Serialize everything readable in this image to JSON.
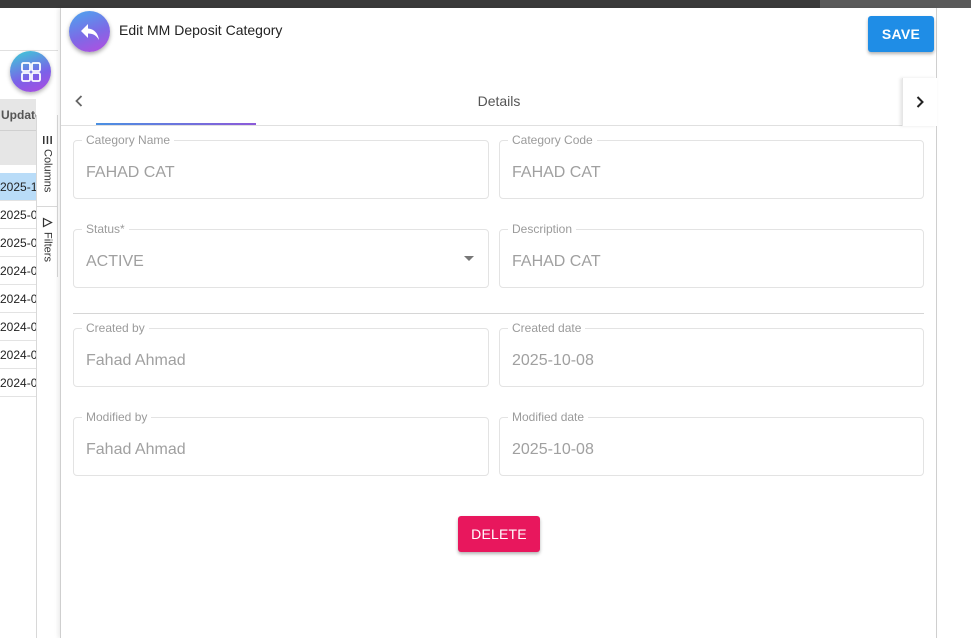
{
  "background_grid": {
    "header_label": "Update",
    "rows": [
      "2025-1",
      "2025-0",
      "2025-0",
      "2024-0",
      "2024-0",
      "2024-0",
      "2024-0",
      "2024-0"
    ],
    "side_tabs": {
      "columns": "Columns",
      "filters": "Filters"
    }
  },
  "dialog": {
    "title": "Edit MM Deposit Category",
    "save_label": "SAVE",
    "delete_label": "DELETE",
    "tab_label": "Details",
    "fields": {
      "category_name": {
        "label": "Category Name",
        "value": "FAHAD CAT"
      },
      "category_code": {
        "label": "Category Code",
        "value": "FAHAD CAT"
      },
      "status": {
        "label": "Status*",
        "value": "ACTIVE"
      },
      "description": {
        "label": "Description",
        "value": "FAHAD CAT"
      },
      "created_by": {
        "label": "Created by",
        "value": "Fahad Ahmad"
      },
      "created_date": {
        "label": "Created date",
        "value": "2025-10-08"
      },
      "modified_by": {
        "label": "Modified by",
        "value": "Fahad Ahmad"
      },
      "modified_date": {
        "label": "Modified date",
        "value": "2025-10-08"
      }
    }
  },
  "colors": {
    "save_button": "#1f8de6",
    "delete_button": "#e8175d",
    "selected_row": "#b9dcf8"
  },
  "icons": {
    "back": "back-arrow-icon",
    "apps": "apps-grid-icon",
    "tab_prev": "chevron-left-icon",
    "tab_next": "chevron-right-icon",
    "status_dropdown": "caret-down-icon",
    "columns": "columns-icon",
    "filters": "filter-icon"
  }
}
